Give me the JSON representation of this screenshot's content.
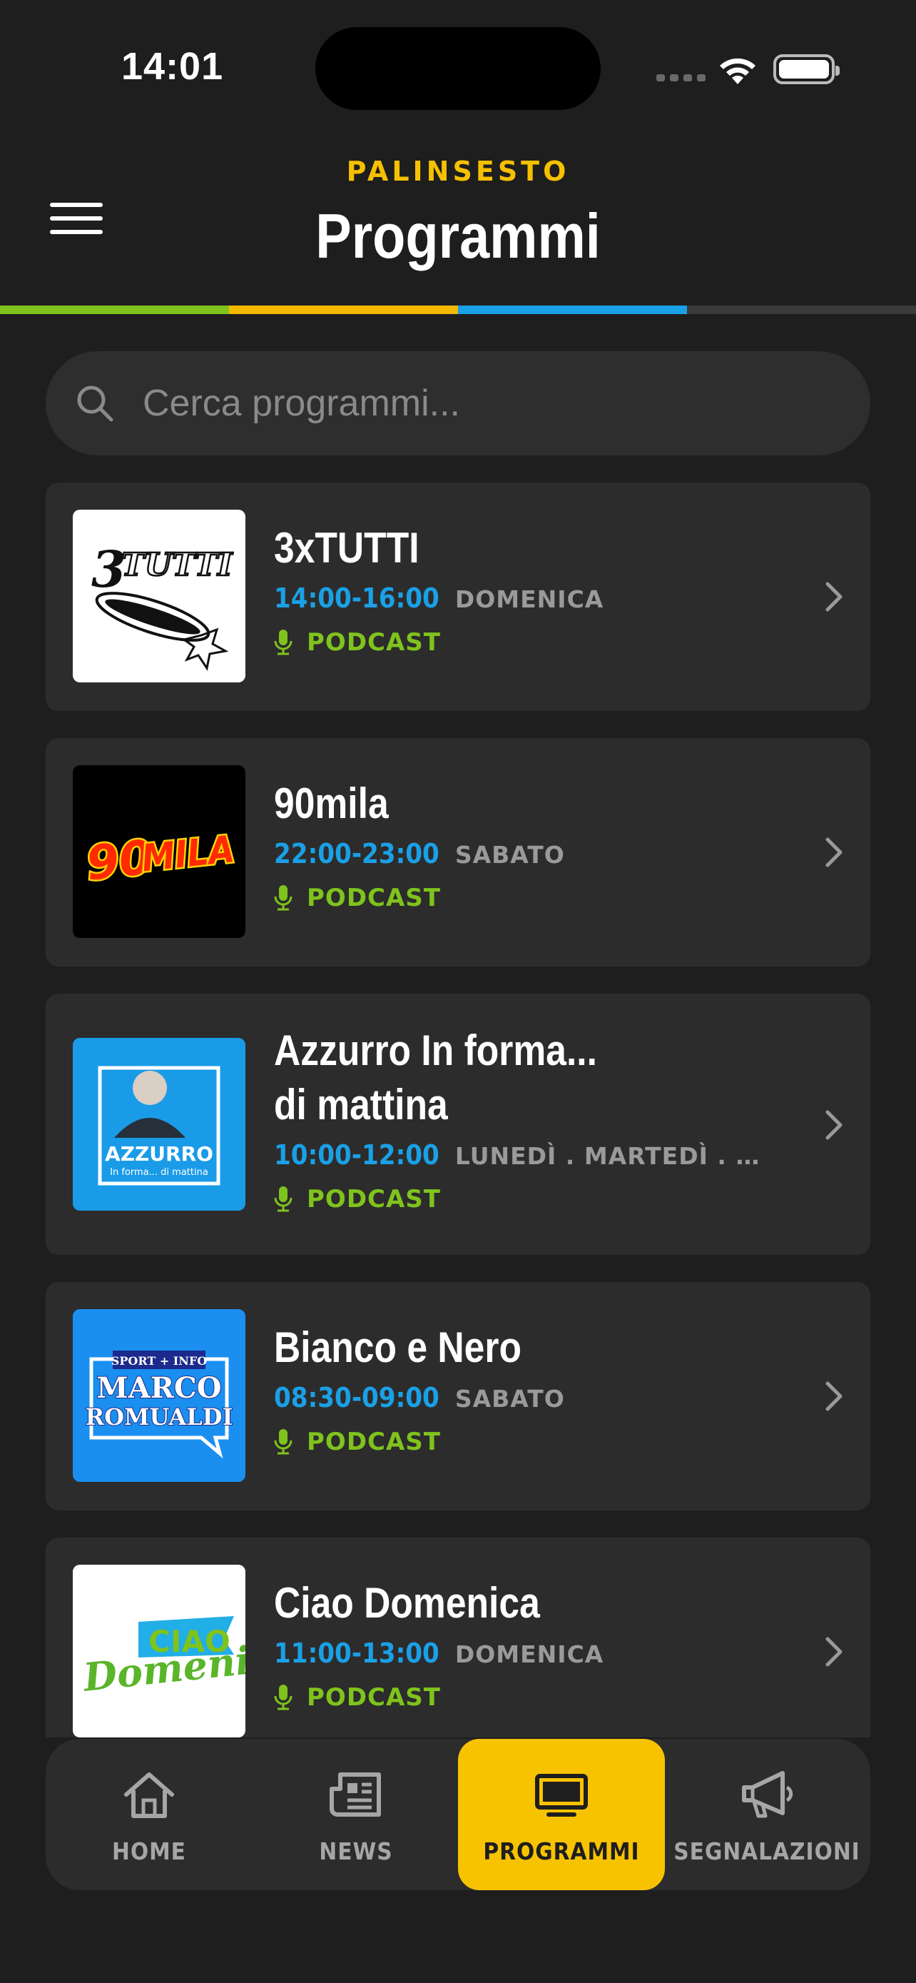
{
  "status_bar": {
    "time": "14:01"
  },
  "header": {
    "kicker": "PALINSESTO",
    "title": "Programmi",
    "stripe_colors": [
      "#7fc31c",
      "#f5b800",
      "#1aa0e6",
      "#3a3a3a"
    ]
  },
  "search": {
    "placeholder": "Cerca programmi..."
  },
  "programs": [
    {
      "title_lines": [
        "3xTUTTI"
      ],
      "hours": "14:00-16:00",
      "days": "DOMENICA",
      "badge": "PODCAST"
    },
    {
      "title_lines": [
        "90mila"
      ],
      "hours": "22:00-23:00",
      "days": "SABATO",
      "badge": "PODCAST"
    },
    {
      "title_lines": [
        "Azzurro In forma...",
        "di mattina"
      ],
      "hours": "10:00-12:00",
      "days": "LUNEDÌ . MARTEDÌ . MERCO...",
      "badge": "PODCAST"
    },
    {
      "title_lines": [
        "Bianco e Nero"
      ],
      "hours": "08:30-09:00",
      "days": "SABATO",
      "badge": "PODCAST"
    },
    {
      "title_lines": [
        "Ciao Domenica"
      ],
      "hours": "11:00-13:00",
      "days": "DOMENICA",
      "badge": "PODCAST"
    }
  ],
  "thumbnails": {
    "p0": {
      "text": "3xTUTTI",
      "bg": "#ffffff"
    },
    "p1": {
      "text": "90MILA",
      "bg": "#000000"
    },
    "p2": {
      "text": "AZZURRO",
      "subtext": "In forma... di mattina",
      "bg": "#1a9be8"
    },
    "p3": {
      "text_top": "SPORT + INFO",
      "text": "MARCO",
      "text2": "ROMUALDI",
      "bg": "#1a8ff0"
    },
    "p4": {
      "text": "CIAO",
      "text2": "Domenica",
      "bg": "#ffffff"
    }
  },
  "tabs": [
    {
      "label": "HOME",
      "icon": "home-icon",
      "active": false
    },
    {
      "label": "NEWS",
      "icon": "newspaper-icon",
      "active": false
    },
    {
      "label": "PROGRAMMI",
      "icon": "tv-icon",
      "active": true
    },
    {
      "label": "SEGNALAZIONI",
      "icon": "megaphone-icon",
      "active": false
    }
  ],
  "colors": {
    "accent": "#f7c300",
    "time_blue": "#1aa0e6",
    "podcast_green": "#7fc31c"
  }
}
